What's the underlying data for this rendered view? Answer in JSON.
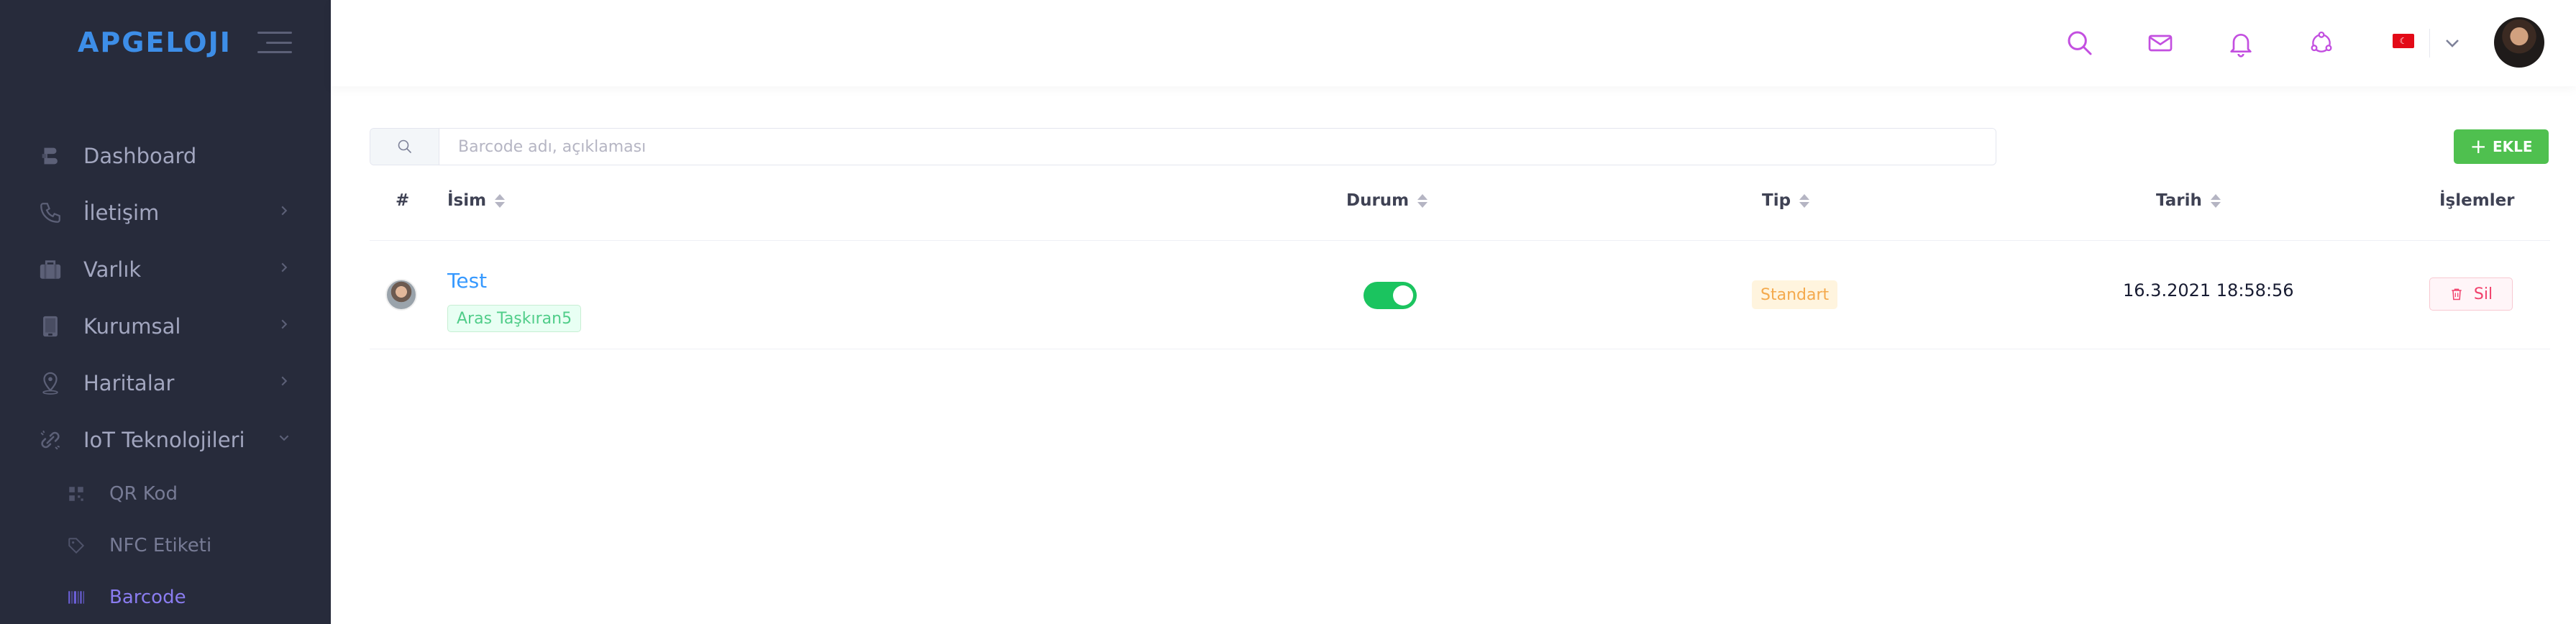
{
  "brand": {
    "logo_text": "APGELOJI"
  },
  "sidebar": {
    "items": [
      {
        "label": "Dashboard",
        "icon": "dashboard-icon",
        "has_chevron": false
      },
      {
        "label": "İletişim",
        "icon": "phone-icon",
        "has_chevron": true
      },
      {
        "label": "Varlık",
        "icon": "briefcase-icon",
        "has_chevron": true
      },
      {
        "label": "Kurumsal",
        "icon": "building-icon",
        "has_chevron": true
      },
      {
        "label": "Haritalar",
        "icon": "map-pin-icon",
        "has_chevron": true
      },
      {
        "label": "IoT Teknolojileri",
        "icon": "iot-link-icon",
        "has_chevron": true,
        "expanded": true
      }
    ],
    "subitems": [
      {
        "label": "QR Kod",
        "icon": "qr-code-icon",
        "active": false
      },
      {
        "label": "NFC Etiketi",
        "icon": "tag-icon",
        "active": false
      },
      {
        "label": "Barcode",
        "icon": "barcode-icon",
        "active": true
      }
    ]
  },
  "topbar": {
    "icons": [
      "search-icon",
      "mail-icon",
      "bell-icon",
      "network-icon"
    ],
    "language_flag": "turkey-flag-icon",
    "icon_color": "#c34fe0"
  },
  "search": {
    "placeholder": "Barcode adı, açıklaması",
    "value": ""
  },
  "add_button": {
    "label": "EKLE"
  },
  "table": {
    "headers": {
      "index": "#",
      "name": "İsim",
      "status": "Durum",
      "type": "Tip",
      "date": "Tarih",
      "actions": "İşlemler"
    },
    "rows": [
      {
        "name": "Test",
        "owner": "Aras Taşkıran5",
        "status": true,
        "type": "Standart",
        "date": "16.3.2021 18:58:56",
        "delete_label": "Sil"
      }
    ]
  },
  "colors": {
    "sidebar_bg": "#272b3b",
    "accent_purple": "#8a7cf0",
    "add_green": "#4fc04f",
    "toggle_green": "#1bc45f",
    "link_blue": "#3699ff",
    "danger": "#f1416c",
    "warning": "#f4a94c"
  }
}
